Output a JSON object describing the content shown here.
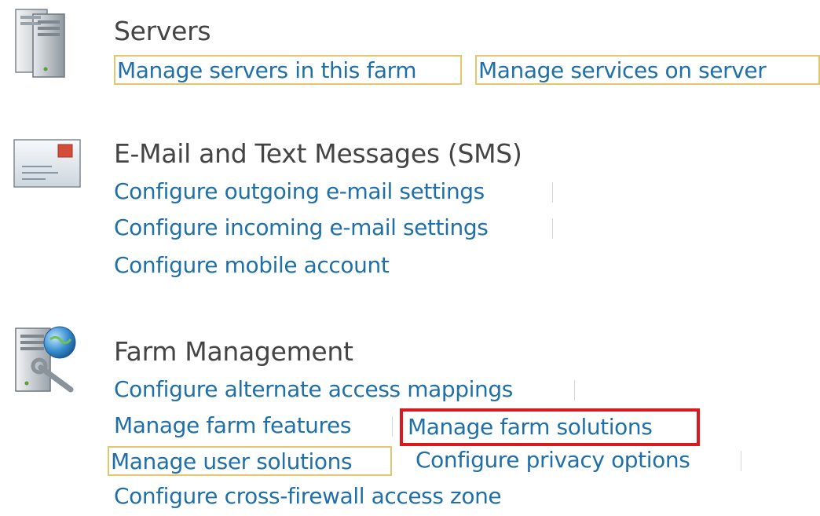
{
  "sections": {
    "servers": {
      "icon": "server-tower-icon",
      "title": "Servers",
      "links": [
        "Manage servers in this farm",
        "Manage services on server"
      ]
    },
    "email": {
      "icon": "envelope-icon",
      "title": "E-Mail and Text Messages (SMS)",
      "links": [
        "Configure outgoing e-mail settings",
        "Configure incoming e-mail settings",
        "Configure mobile account"
      ]
    },
    "farm": {
      "icon": "farm-management-icon",
      "title": "Farm Management",
      "links": [
        "Configure alternate access mappings",
        "Manage farm features",
        "Manage farm solutions",
        "Manage user solutions",
        "Configure privacy options",
        "Configure cross-firewall access zone"
      ]
    }
  },
  "colors": {
    "link": "#1f6fa8",
    "title": "#444444",
    "focus_border": "#e8c56a",
    "highlight_border": "#d9191d"
  }
}
